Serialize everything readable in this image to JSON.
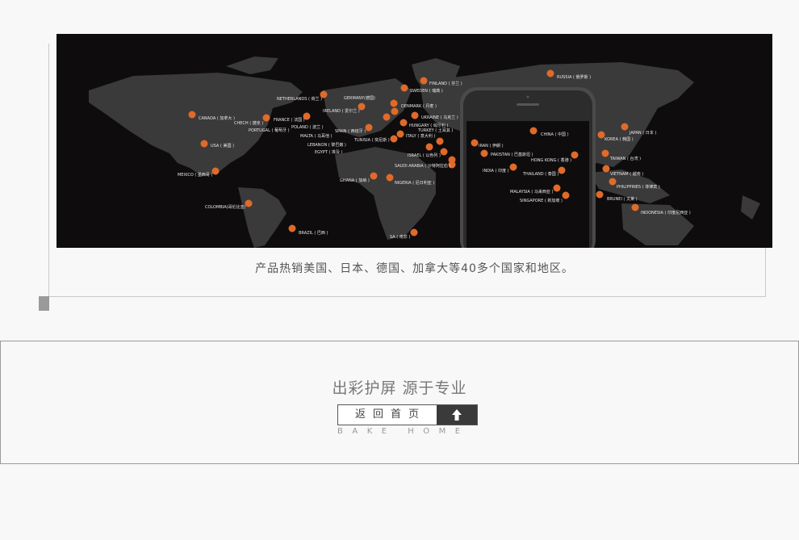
{
  "caption": "产品热销美国、日本、德国、加拿大等40多个国家和地区。",
  "slogan": "出彩护屏 源于专业",
  "home_button_label": "返回首页",
  "home_sub": "BAKE HOME",
  "accent": "#e06a2a",
  "map_labels": [
    {
      "id": "netherlands",
      "text": "NETHERLANDS ( 荷兰 )"
    },
    {
      "id": "germany",
      "text": "GERMANY(德国)"
    },
    {
      "id": "finland",
      "text": "FINLAND ( 芬兰 )"
    },
    {
      "id": "russia",
      "text": "RUSSIA ( 俄罗斯 )"
    },
    {
      "id": "sweden",
      "text": "SWEDEN ( 瑞典 )"
    },
    {
      "id": "ireland",
      "text": "IRELAND ( 爱尔兰 )"
    },
    {
      "id": "denmark",
      "text": "DENMARK ( 丹麦 )"
    },
    {
      "id": "canada",
      "text": "CANADA ( 加拿大 )"
    },
    {
      "id": "france",
      "text": "FRANCE ( 法国 )"
    },
    {
      "id": "czech",
      "text": "CHECH ( 捷克 )"
    },
    {
      "id": "ukraine",
      "text": "UKRAINE ( 乌克兰 )"
    },
    {
      "id": "hungary",
      "text": "HUNGARY ( 匈牙利 )"
    },
    {
      "id": "poland",
      "text": "POLAND ( 波兰 )"
    },
    {
      "id": "portugal",
      "text": "PORTUGAL ( 葡萄牙 )"
    },
    {
      "id": "spain",
      "text": "SPAIN ( 西班牙 )"
    },
    {
      "id": "turkey",
      "text": "TURKEY ( 土耳其 )"
    },
    {
      "id": "italy",
      "text": "ITALY ( 意大利 )"
    },
    {
      "id": "malta",
      "text": "MALTA ( 马耳他 )"
    },
    {
      "id": "tunisia",
      "text": "TUNISIA ( 突尼斯 )"
    },
    {
      "id": "china",
      "text": "CHINA ( 中国 )"
    },
    {
      "id": "korea",
      "text": "KOREA ( 韩国 )"
    },
    {
      "id": "japan",
      "text": "JAPAN ( 日本 )"
    },
    {
      "id": "usa",
      "text": "USA ( 美国 )"
    },
    {
      "id": "lebanon",
      "text": "LEBANON ( 黎巴嫩 )"
    },
    {
      "id": "egypt",
      "text": "EGYPT ( 埃及 )"
    },
    {
      "id": "iran",
      "text": "IRAN ( 伊朗 )"
    },
    {
      "id": "israel",
      "text": "ISRAEL ( 以色列 )"
    },
    {
      "id": "pakistan",
      "text": "PAKISTAN ( 巴基斯坦 )"
    },
    {
      "id": "taiwan",
      "text": "TAIWAN ( 台湾 )"
    },
    {
      "id": "hongkong",
      "text": "HONG KONG ( 香港 )"
    },
    {
      "id": "saudi",
      "text": "SAUDI ARABIA ( 沙特阿拉伯 )"
    },
    {
      "id": "india",
      "text": "INDIA ( 印度 )"
    },
    {
      "id": "vietnam",
      "text": "VIETNAM ( 越南 )"
    },
    {
      "id": "thailand",
      "text": "THAILAND ( 泰国 )"
    },
    {
      "id": "mexico",
      "text": "MEXICO ( 墨西哥 )"
    },
    {
      "id": "ghana",
      "text": "GHANA ( 加纳 )"
    },
    {
      "id": "nigeria",
      "text": "NIGERIA ( 尼日利亚 )"
    },
    {
      "id": "philippines",
      "text": "PHILIPPINES ( 菲律宾 )"
    },
    {
      "id": "malaysia",
      "text": "MALAYSIA ( 马来西亚 )"
    },
    {
      "id": "singapore",
      "text": "SINGAPORE ( 新加坡 )"
    },
    {
      "id": "brunei",
      "text": "BRUNEI ( 文莱 )"
    },
    {
      "id": "indonesia",
      "text": "INDONESIA ( 印度尼西亚 )"
    },
    {
      "id": "colombia",
      "text": "COLOMBIA(哥伦比亚)"
    },
    {
      "id": "brazil",
      "text": "BRAZIL ( 巴西 )"
    },
    {
      "id": "sa",
      "text": "SA ( 南非 )"
    }
  ]
}
